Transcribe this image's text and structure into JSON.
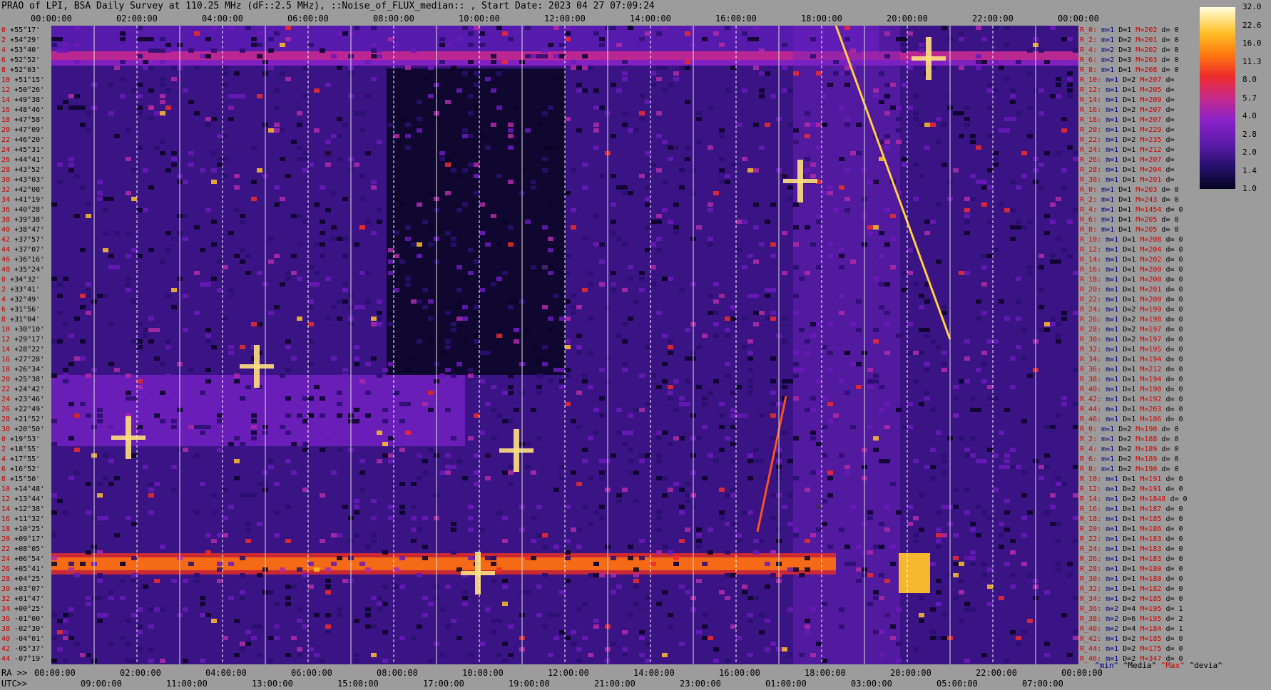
{
  "title": "PRAO of LPI, BSA Daily Survey at 110.25 MHz (dF::2.5 MHz), ::Noise_of_FLUX_median:: , Start Date: 2023 04 27 07:09:24",
  "ra_prefix": "RA >>",
  "utc_prefix": "UTC>>",
  "legend": {
    "min": "^min^",
    "median": "^Media^",
    "max": "^Max^",
    "devia": "^devia^"
  },
  "colors": {
    "background": "#9c9c9c",
    "plot_base": "#14093a",
    "row_label": "#d00000",
    "m_label": "#000080",
    "max_label": "#d00000"
  },
  "chart_data": {
    "type": "heatmap",
    "title": "PRAO of LPI, BSA Daily Survey at 110.25 MHz (dF::2.5 MHz), ::Noise_of_FLUX_median:: , Start Date: 2023 04 27 07:09:24",
    "x_top_ticks": [
      "00:00:00",
      "02:00:00",
      "04:00:00",
      "06:00:00",
      "08:00:00",
      "10:00:00",
      "12:00:00",
      "14:00:00",
      "16:00:00",
      "18:00:00",
      "20:00:00",
      "22:00:00",
      "00:00:00"
    ],
    "ra_ticks": [
      "00:00:00",
      "02:00:00",
      "04:00:00",
      "06:00:00",
      "08:00:00",
      "10:00:00",
      "12:00:00",
      "14:00:00",
      "16:00:00",
      "18:00:00",
      "20:00:00",
      "22:00:00",
      "00:00:00"
    ],
    "utc_ticks": [
      "09:00:00",
      "11:00:00",
      "13:00:00",
      "15:00:00",
      "17:00:00",
      "19:00:00",
      "21:00:00",
      "23:00:00",
      "01:00:00",
      "03:00:00",
      "05:00:00",
      "07:00:00"
    ],
    "x_range_hours": [
      0,
      24
    ],
    "colorbar": {
      "ticks": [
        "32.0",
        "22.6",
        "16.0",
        "11.3",
        "8.0",
        "5.7",
        "4.0",
        "2.8",
        "2.0",
        "1.4",
        "1.0"
      ],
      "range": [
        1.0,
        32.0
      ],
      "scale": "log"
    },
    "declination_labels": [
      [
        "0",
        "+55°17'"
      ],
      [
        "2",
        "+54°29'"
      ],
      [
        "4",
        "+53°40'"
      ],
      [
        "6",
        "+52°52'"
      ],
      [
        "8",
        "+52°03'"
      ],
      [
        "10",
        "+51°15'"
      ],
      [
        "12",
        "+50°26'"
      ],
      [
        "14",
        "+49°38'"
      ],
      [
        "16",
        "+48°46'"
      ],
      [
        "18",
        "+47°58'"
      ],
      [
        "20",
        "+47°09'"
      ],
      [
        "22",
        "+46°20'"
      ],
      [
        "24",
        "+45°31'"
      ],
      [
        "26",
        "+44°41'"
      ],
      [
        "28",
        "+43°52'"
      ],
      [
        "30",
        "+43°03'"
      ],
      [
        "32",
        "+42°08'"
      ],
      [
        "34",
        "+41°19'"
      ],
      [
        "36",
        "+40°28'"
      ],
      [
        "38",
        "+39°38'"
      ],
      [
        "40",
        "+38°47'"
      ],
      [
        "42",
        "+37°57'"
      ],
      [
        "44",
        "+37°07'"
      ],
      [
        "46",
        "+36°16'"
      ],
      [
        "48",
        "+35°24'"
      ],
      [
        "0",
        "+34°32'"
      ],
      [
        "2",
        "+33°41'"
      ],
      [
        "4",
        "+32°49'"
      ],
      [
        "6",
        "+31°56'"
      ],
      [
        "8",
        "+31°04'"
      ],
      [
        "10",
        "+30°10'"
      ],
      [
        "12",
        "+29°17'"
      ],
      [
        "14",
        "+28°22'"
      ],
      [
        "16",
        "+27°28'"
      ],
      [
        "18",
        "+26°34'"
      ],
      [
        "20",
        "+25°38'"
      ],
      [
        "22",
        "+24°42'"
      ],
      [
        "24",
        "+23°46'"
      ],
      [
        "26",
        "+22°49'"
      ],
      [
        "28",
        "+21°52'"
      ],
      [
        "30",
        "+20°50'"
      ],
      [
        "0",
        "+19°53'"
      ],
      [
        "2",
        "+18°55'"
      ],
      [
        "4",
        "+17°55'"
      ],
      [
        "6",
        "+16°52'"
      ],
      [
        "8",
        "+15°50'"
      ],
      [
        "10",
        "+14°48'"
      ],
      [
        "12",
        "+13°44'"
      ],
      [
        "14",
        "+12°38'"
      ],
      [
        "16",
        "+11°32'"
      ],
      [
        "18",
        "+10°25'"
      ],
      [
        "20",
        "+09°17'"
      ],
      [
        "22",
        "+08°05'"
      ],
      [
        "24",
        "+06°54'"
      ],
      [
        "26",
        "+05°41'"
      ],
      [
        "28",
        "+04°25'"
      ],
      [
        "30",
        "+03°07'"
      ],
      [
        "32",
        "+01°47'"
      ],
      [
        "34",
        "+00°25'"
      ],
      [
        "36",
        "-01°00'"
      ],
      [
        "38",
        "-02°30'"
      ],
      [
        "40",
        "-04°01'"
      ],
      [
        "42",
        "-05°37'"
      ],
      [
        "44",
        "-07°19'"
      ]
    ],
    "row_stats": [
      [
        "R_0:",
        "m=1",
        "D=1",
        "M=202",
        "d= 0"
      ],
      [
        "R_2:",
        "m=1",
        "D=2",
        "M=201",
        "d= 0"
      ],
      [
        "R_4:",
        "m=2",
        "D=3",
        "M=202",
        "d= 0"
      ],
      [
        "R_6:",
        "m=2",
        "D=3",
        "M=203",
        "d= 0"
      ],
      [
        "R_8:",
        "m=1",
        "D=1",
        "M=208",
        "d= 0"
      ],
      [
        "R_10:",
        "m=1",
        "D=2",
        "M=207",
        "d="
      ],
      [
        "R_12:",
        "m=1",
        "D=1",
        "M=205",
        "d="
      ],
      [
        "R_14:",
        "m=1",
        "D=1",
        "M=209",
        "d="
      ],
      [
        "R_16:",
        "m=1",
        "D=2",
        "M=207",
        "d="
      ],
      [
        "R_18:",
        "m=1",
        "D=1",
        "M=207",
        "d="
      ],
      [
        "R_20:",
        "m=1",
        "D=1",
        "M=229",
        "d="
      ],
      [
        "R_22:",
        "m=1",
        "D=2",
        "M=235",
        "d="
      ],
      [
        "R_24:",
        "m=1",
        "D=1",
        "M=212",
        "d="
      ],
      [
        "R_26:",
        "m=1",
        "D=1",
        "M=207",
        "d="
      ],
      [
        "R_28:",
        "m=1",
        "D=1",
        "M=204",
        "d="
      ],
      [
        "R_30:",
        "m=1",
        "D=1",
        "M=201",
        "d="
      ],
      [
        "R_0:",
        "m=1",
        "D=1",
        "M=203",
        "d= 0"
      ],
      [
        "R_2:",
        "m=1",
        "D=1",
        "M=243",
        "d= 0"
      ],
      [
        "R_4:",
        "m=1",
        "D=1",
        "M=1454",
        "d= 0"
      ],
      [
        "R_6:",
        "m=1",
        "D=1",
        "M=205",
        "d= 0"
      ],
      [
        "R_8:",
        "m=1",
        "D=1",
        "M=205",
        "d= 0"
      ],
      [
        "R_10:",
        "m=1",
        "D=1",
        "M=208",
        "d= 0"
      ],
      [
        "R_12:",
        "m=1",
        "D=1",
        "M=204",
        "d= 0"
      ],
      [
        "R_14:",
        "m=1",
        "D=1",
        "M=202",
        "d= 0"
      ],
      [
        "R_16:",
        "m=1",
        "D=1",
        "M=200",
        "d= 0"
      ],
      [
        "R_18:",
        "m=1",
        "D=1",
        "M=200",
        "d= 0"
      ],
      [
        "R_20:",
        "m=1",
        "D=1",
        "M=201",
        "d= 0"
      ],
      [
        "R_22:",
        "m=1",
        "D=1",
        "M=200",
        "d= 0"
      ],
      [
        "R_24:",
        "m=1",
        "D=2",
        "M=199",
        "d= 0"
      ],
      [
        "R_26:",
        "m=1",
        "D=2",
        "M=198",
        "d= 0"
      ],
      [
        "R_28:",
        "m=1",
        "D=2",
        "M=197",
        "d= 0"
      ],
      [
        "R_30:",
        "m=1",
        "D=2",
        "M=197",
        "d= 0"
      ],
      [
        "R_32:",
        "m=1",
        "D=1",
        "M=195",
        "d= 0"
      ],
      [
        "R_34:",
        "m=1",
        "D=1",
        "M=194",
        "d= 0"
      ],
      [
        "R_36:",
        "m=1",
        "D=1",
        "M=212",
        "d= 0"
      ],
      [
        "R_38:",
        "m=1",
        "D=1",
        "M=194",
        "d= 0"
      ],
      [
        "R_40:",
        "m=1",
        "D=1",
        "M=190",
        "d= 0"
      ],
      [
        "R_42:",
        "m=1",
        "D=1",
        "M=192",
        "d= 0"
      ],
      [
        "R_44:",
        "m=1",
        "D=1",
        "M=203",
        "d= 0"
      ],
      [
        "R_46:",
        "m=1",
        "D=1",
        "M=186",
        "d= 0"
      ],
      [
        "R_0:",
        "m=1",
        "D=2",
        "M=190",
        "d= 0"
      ],
      [
        "R_2:",
        "m=1",
        "D=2",
        "M=188",
        "d= 0"
      ],
      [
        "R_4:",
        "m=1",
        "D=2",
        "M=189",
        "d= 0"
      ],
      [
        "R_6:",
        "m=1",
        "D=2",
        "M=189",
        "d= 0"
      ],
      [
        "R_8:",
        "m=1",
        "D=2",
        "M=190",
        "d= 0"
      ],
      [
        "R_10:",
        "m=1",
        "D=1",
        "M=191",
        "d= 0"
      ],
      [
        "R_12:",
        "m=1",
        "D=2",
        "M=191",
        "d= 0"
      ],
      [
        "R_14:",
        "m=1",
        "D=2",
        "M=1848",
        "d= 0"
      ],
      [
        "R_16:",
        "m=1",
        "D=1",
        "M=187",
        "d= 0"
      ],
      [
        "R_18:",
        "m=1",
        "D=1",
        "M=185",
        "d= 0"
      ],
      [
        "R_20:",
        "m=1",
        "D=1",
        "M=186",
        "d= 0"
      ],
      [
        "R_22:",
        "m=1",
        "D=1",
        "M=183",
        "d= 0"
      ],
      [
        "R_24:",
        "m=1",
        "D=1",
        "M=183",
        "d= 0"
      ],
      [
        "R_26:",
        "m=1",
        "D=1",
        "M=183",
        "d= 0"
      ],
      [
        "R_28:",
        "m=1",
        "D=1",
        "M=180",
        "d= 0"
      ],
      [
        "R_30:",
        "m=1",
        "D=1",
        "M=180",
        "d= 0"
      ],
      [
        "R_32:",
        "m=1",
        "D=1",
        "M=182",
        "d= 0"
      ],
      [
        "R_34:",
        "m=1",
        "D=2",
        "M=185",
        "d= 0"
      ],
      [
        "R_36:",
        "m=2",
        "D=4",
        "M=195",
        "d= 1"
      ],
      [
        "R_38:",
        "m=2",
        "D=6",
        "M=195",
        "d= 2"
      ],
      [
        "R_40:",
        "m=2",
        "D=4",
        "M=184",
        "d= 1"
      ],
      [
        "R_42:",
        "m=1",
        "D=2",
        "M=185",
        "d= 0"
      ],
      [
        "R_44:",
        "m=1",
        "D=2",
        "M=175",
        "d= 0"
      ],
      [
        "R_46:",
        "m=1",
        "D=2",
        "M=347",
        "d= 0"
      ]
    ]
  }
}
